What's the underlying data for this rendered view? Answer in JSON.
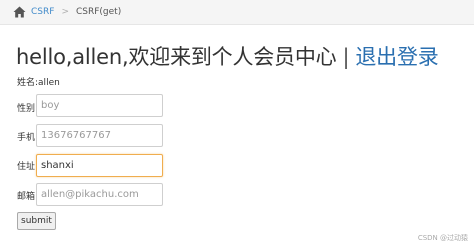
{
  "breadcrumb": {
    "home_icon": "home-icon",
    "link": "CSRF",
    "separator": ">",
    "current": "CSRF(get)"
  },
  "header": {
    "welcome": "hello,allen,欢迎来到个人会员中心",
    "separator": "|",
    "logout": "退出登录"
  },
  "profile": {
    "name_label": "姓名:",
    "name_value": "allen"
  },
  "form": {
    "sex_label": "性别:",
    "sex_value": "boy",
    "phone_label": "手机:",
    "phone_value": "13676767767",
    "address_label": "住址:",
    "address_value": "shanxi",
    "email_label": "邮箱:",
    "email_value": "allen@pikachu.com",
    "submit_label": "submit"
  },
  "watermark": "CSDN @过动猿",
  "colors": {
    "link": "#428bca",
    "logout": "#2a6fb0",
    "focus_border": "#f0ad4e"
  }
}
